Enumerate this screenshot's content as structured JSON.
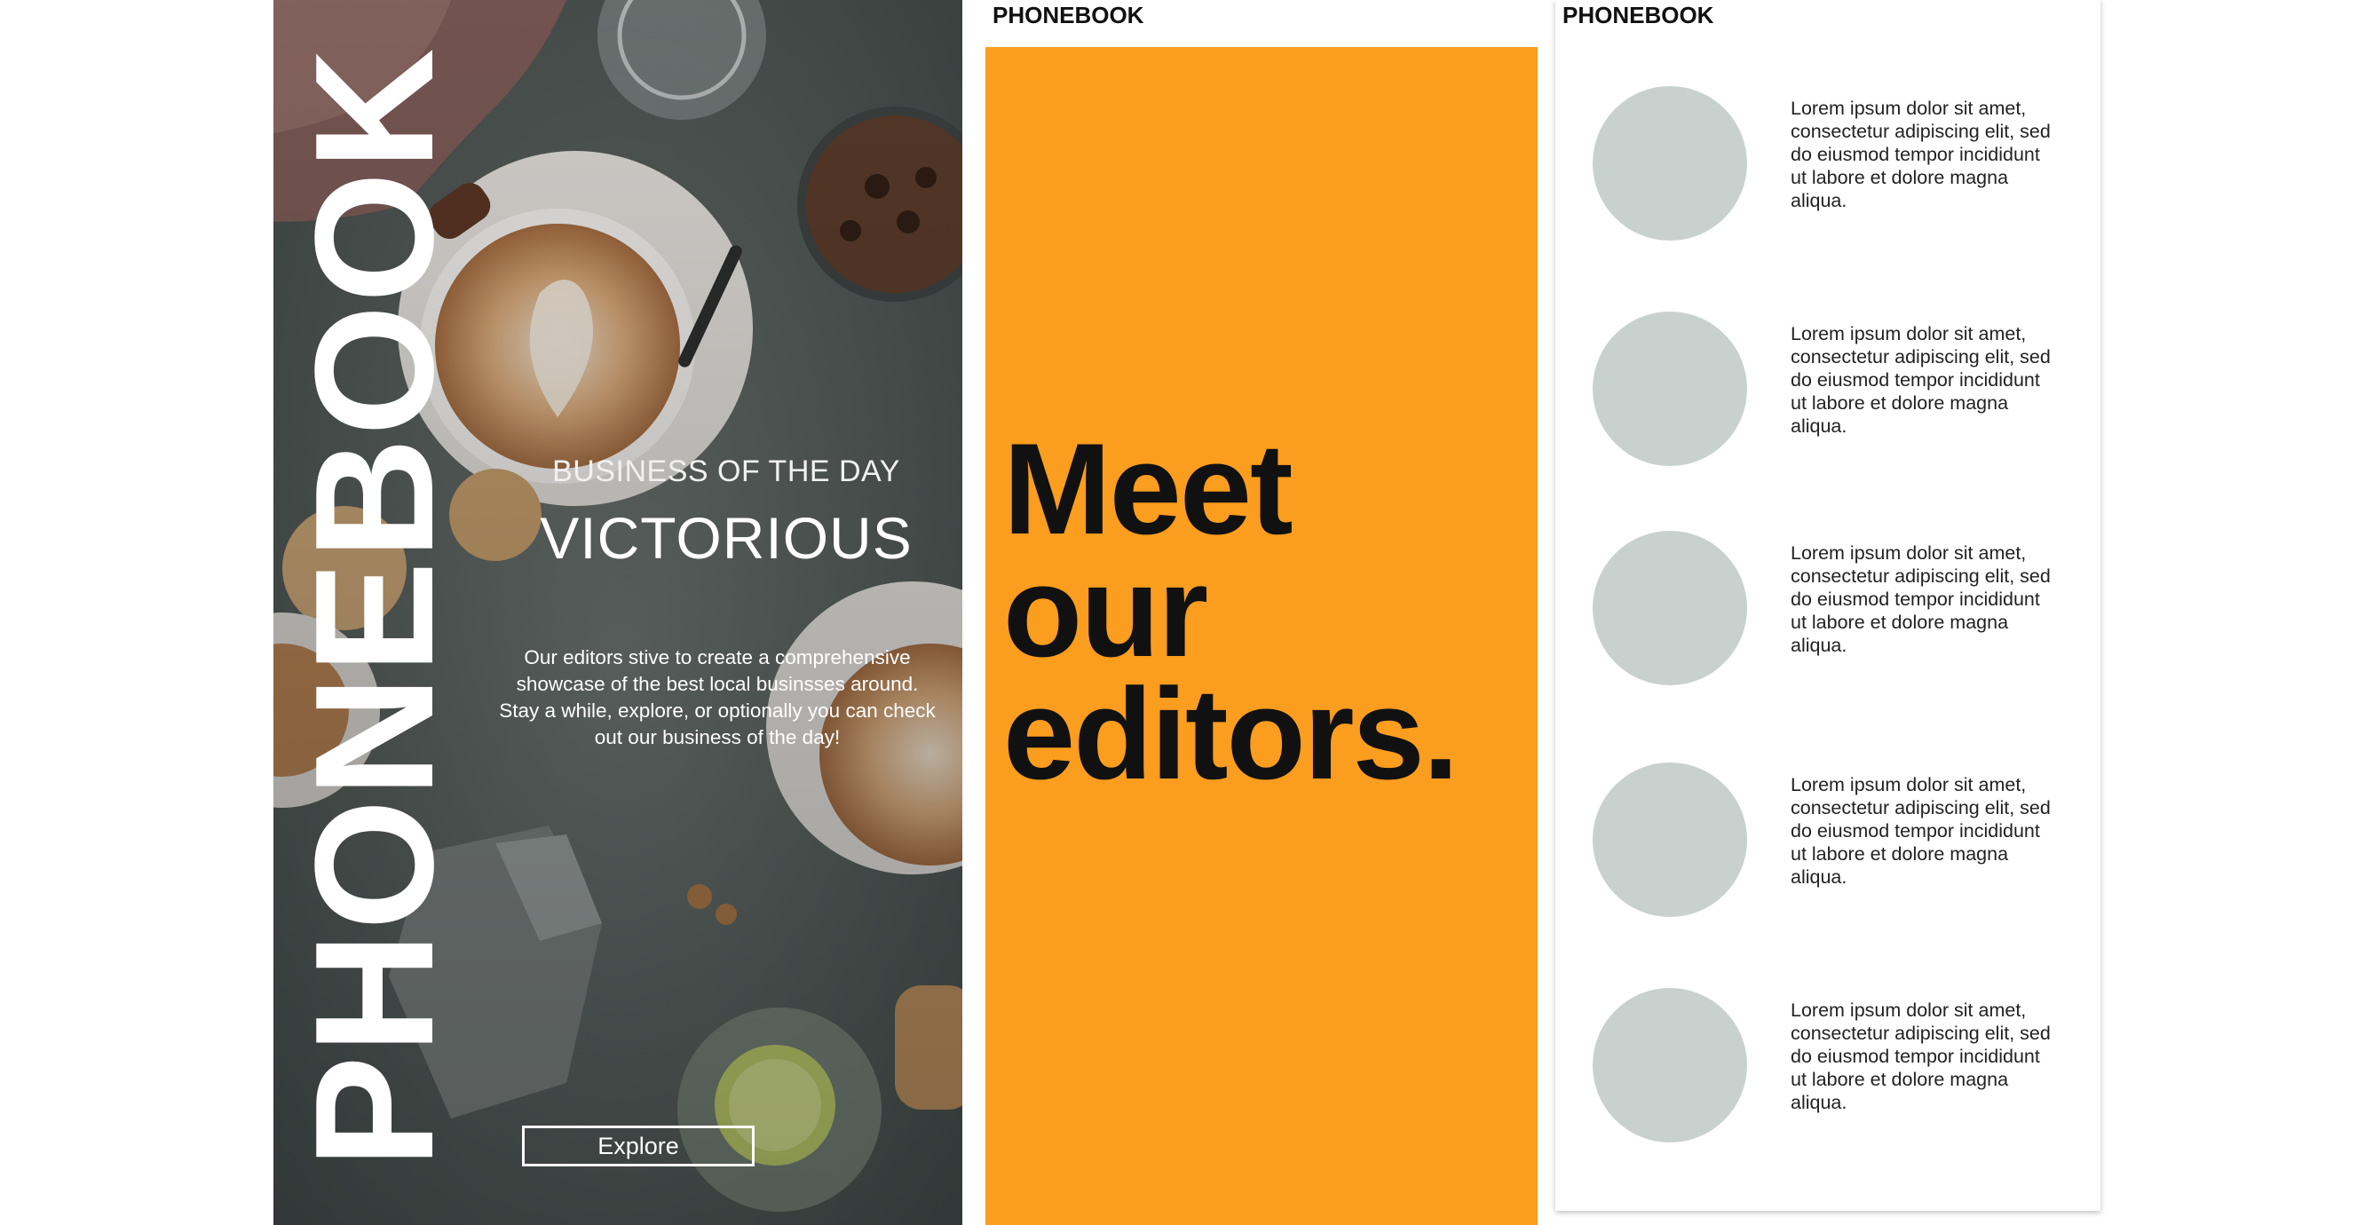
{
  "hero": {
    "brand": "PHONEBOOK",
    "kicker": "BUSINESS OF THE DAY",
    "headline": "VICTORIOUS",
    "blurb": "Our editors stive to create a comprehensive showcase of the best local businsses around. Stay a while, explore, or optionally you can check out our business of the day!",
    "explore_label": "Explore"
  },
  "editors_page": {
    "logo": "PHONEBOOK",
    "heading_line1": "Meet",
    "heading_line2": "our",
    "heading_line3": "editors.",
    "accent_color": "#fb9d1e"
  },
  "editor_list": {
    "logo": "PHONEBOOK",
    "avatar_color": "#c9d1cf",
    "items": [
      {
        "bio": "Lorem ipsum dolor sit amet, consectetur adipiscing elit, sed do eiusmod tempor incididunt ut labore et dolore magna aliqua."
      },
      {
        "bio": "Lorem ipsum dolor sit amet, consectetur adipiscing elit, sed do eiusmod tempor incididunt ut labore et dolore magna aliqua."
      },
      {
        "bio": "Lorem ipsum dolor sit amet, consectetur adipiscing elit, sed do eiusmod tempor incididunt ut labore et dolore magna aliqua."
      },
      {
        "bio": "Lorem ipsum dolor sit amet, consectetur adipiscing elit, sed do eiusmod tempor incididunt ut labore et dolore magna aliqua."
      },
      {
        "bio": "Lorem ipsum dolor sit amet, consectetur adipiscing elit, sed do eiusmod tempor incididunt ut labore et dolore magna aliqua."
      }
    ]
  }
}
